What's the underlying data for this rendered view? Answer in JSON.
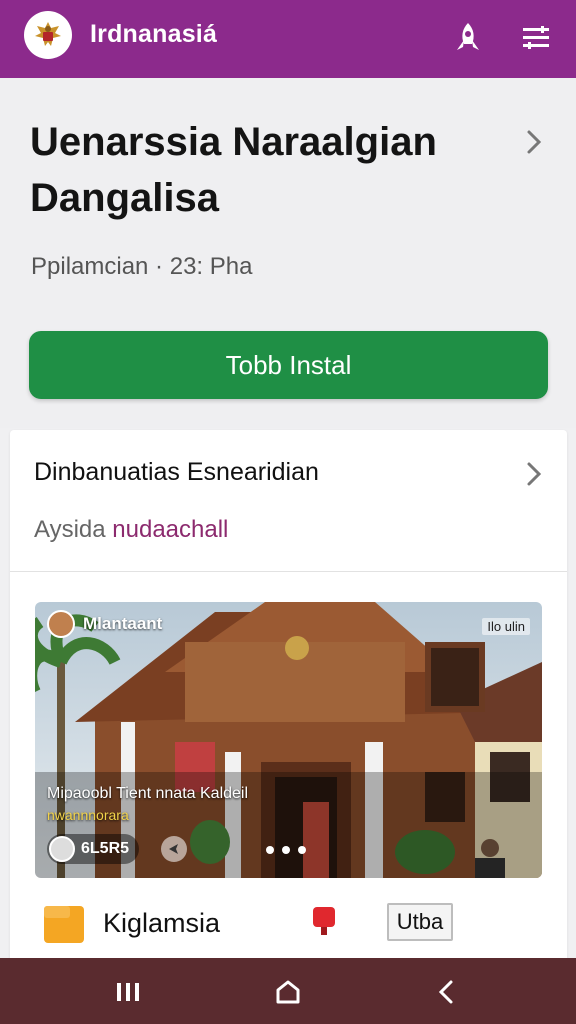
{
  "appbar": {
    "title": "Irdnanasiá",
    "color": "#8c2a8c",
    "logo_icon": "garuda-emblem-icon",
    "actions": [
      "rocket-icon",
      "menu-icon"
    ]
  },
  "header": {
    "title": "Uenarssia Naraalgian Dangalisa",
    "subtitle": "Ppilamcian · 23: Pha",
    "install_label": "Tobb Instal",
    "install_color": "#1f8f45"
  },
  "section": {
    "title": "Dinbanuatias Esnearidian",
    "subtitle_plain": "Aysida ",
    "subtitle_accent": "nudaachall",
    "accent_color": "#8c2a6e"
  },
  "media": {
    "channel_name": "Mlantaant",
    "badge": "Ilo ulin",
    "caption": "Mipaoobl Tient nnata Kaldeil",
    "caption2": "nwannnorara",
    "user_handle": "6L5R5",
    "carousel_dots": 3
  },
  "bottom": {
    "label": "Kiglamsia",
    "button_label": "Utba",
    "folder_color": "#f4a623",
    "mailbox_color": "#e0282e"
  },
  "system_nav": {
    "buttons": [
      "recents-icon",
      "home-icon",
      "back-icon"
    ],
    "color": "#5a2b2f"
  }
}
